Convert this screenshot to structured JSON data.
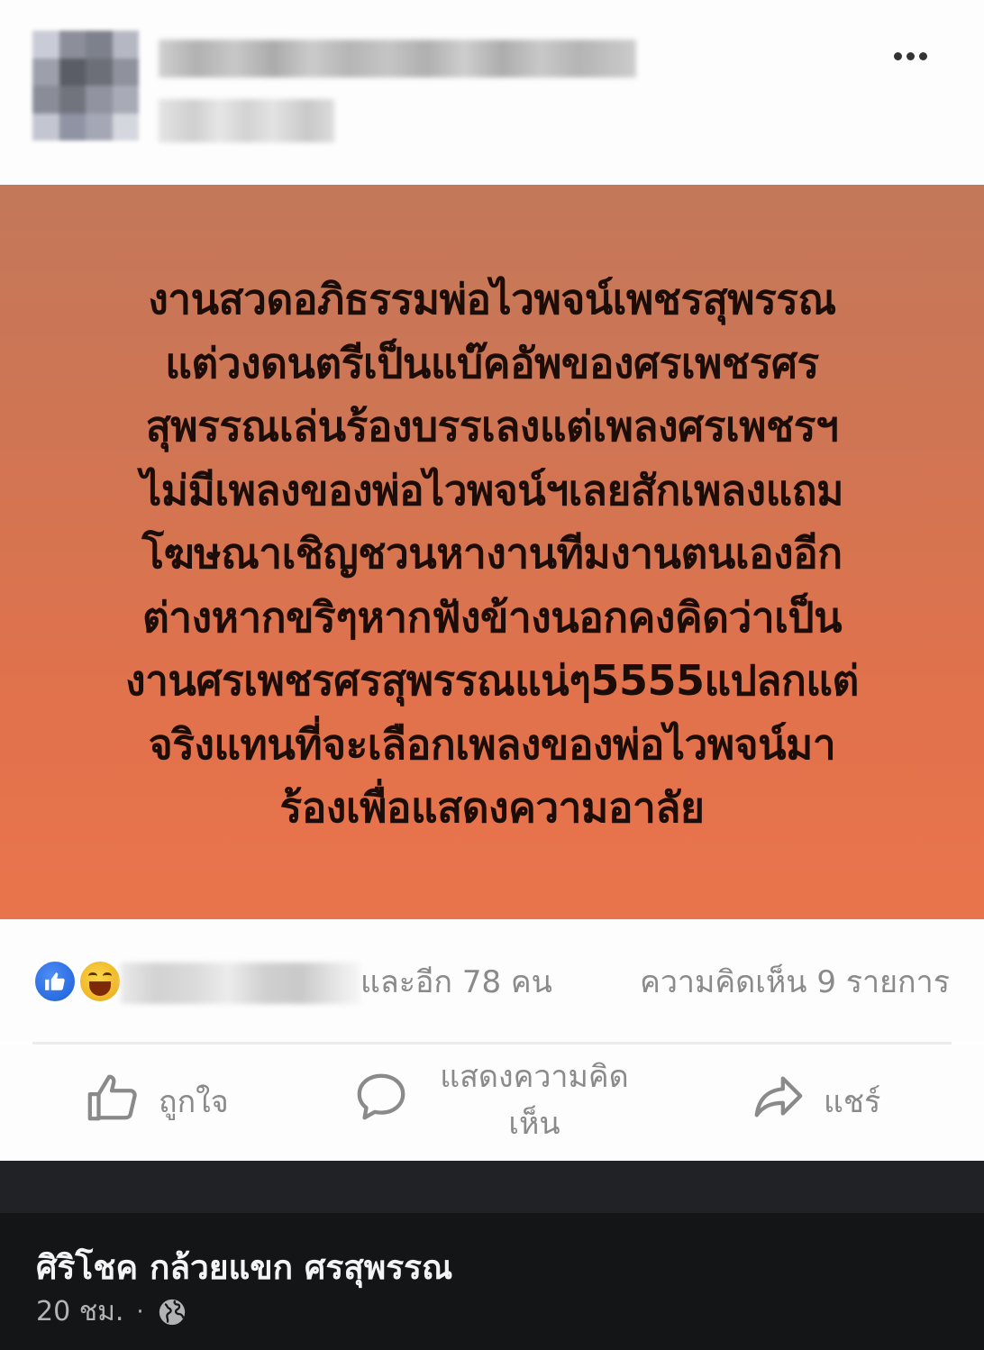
{
  "post": {
    "status_lines": [
      "งานสวดอภิธรรมพ่อไวพจน์เพชรสุพรรณ",
      "แต่วงดนตรีเป็นแบ๊คอัพของศรเพชรศร",
      "สุพรรณเล่นร้องบรรเลงแต่เพลงศรเพชรฯ",
      "ไม่มีเพลงของพ่อไวพจน์ฯเลยสักเพลงแถม",
      "โฆษณาเชิญชวนหางานทีมงานตนเองอีก",
      "ต่างหากขริๆหากฟังข้างนอกคงคิดว่าเป็น",
      "งานศรเพชรศรสุพรรณแน่ๆ5555แปลกแต่",
      "จริงแทนที่จะเลือกเพลงของพ่อไวพจน์มา",
      "ร้องเพื่อแสดงความอาลัย"
    ],
    "status_background": "#e1724c",
    "reaction_count_text": "และอีก 78 คน",
    "comment_count_text": "ความคิดเห็น 9 รายการ"
  },
  "actions": {
    "like": "ถูกใจ",
    "comment": "แสดงความคิดเห็น",
    "share": "แชร์"
  },
  "footer": {
    "poster_name": "ศิริโชค กล้วยแขก ศรสุพรรณ",
    "time": "20 ชม.",
    "separator": "·"
  },
  "icons": {
    "more": "more-dots-icon",
    "like_reaction": "like-reaction-icon",
    "haha_reaction": "haha-reaction-icon",
    "like_action": "thumbs-up-icon",
    "comment_action": "speech-bubble-icon",
    "share_action": "share-arrow-icon",
    "privacy": "globe-icon"
  },
  "colors": {
    "like_blue": "#1b5fd8",
    "haha_yellow": "#fbd54a",
    "dark_footer": "#141517"
  }
}
